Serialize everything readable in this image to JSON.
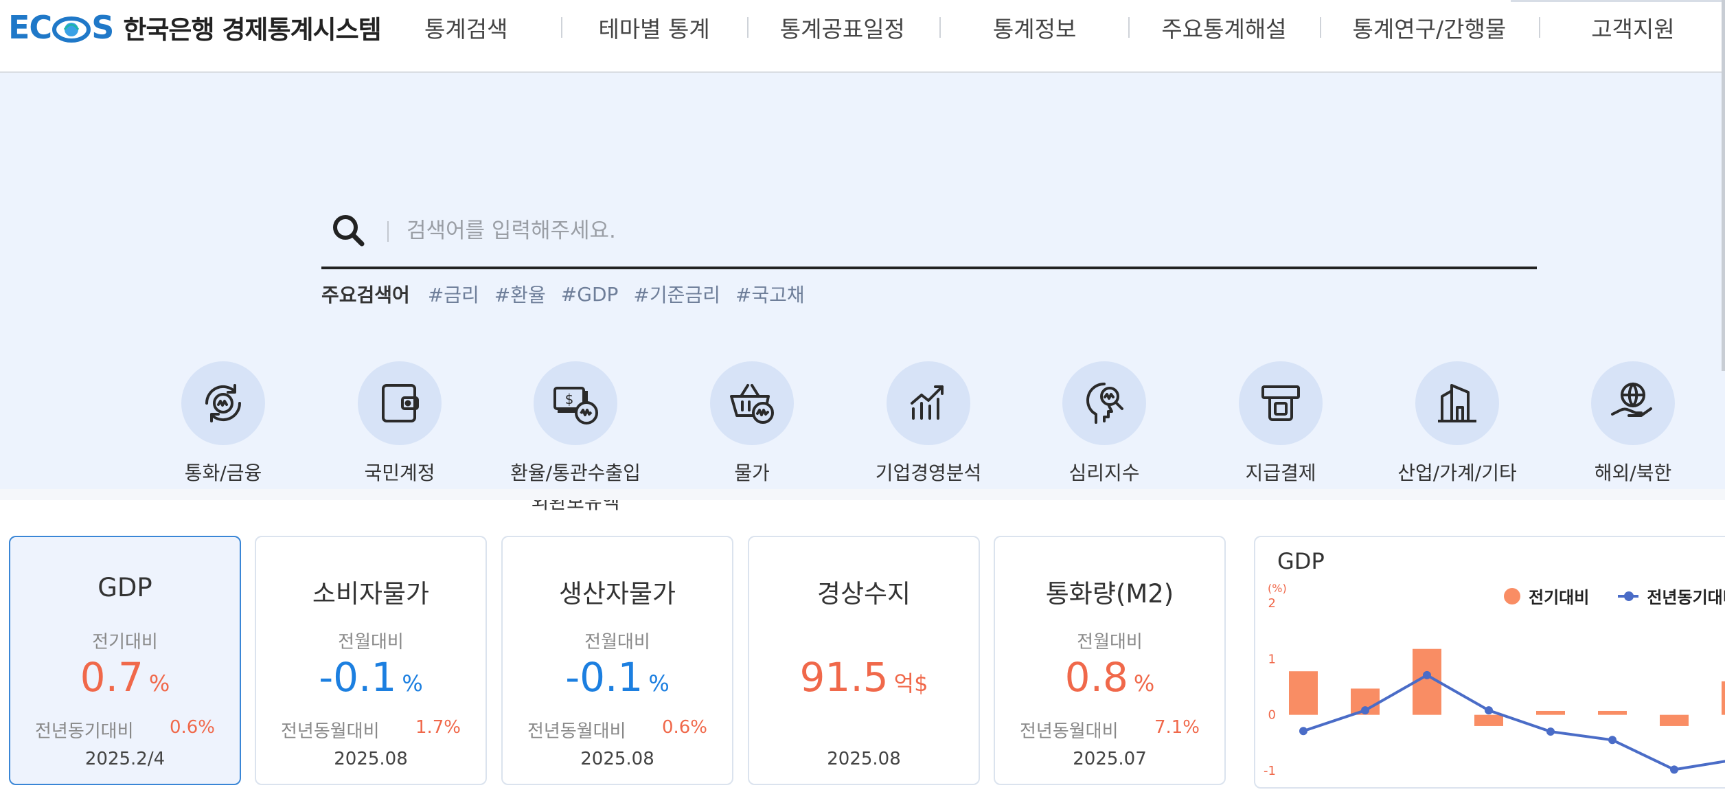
{
  "header": {
    "logo_text": "ECOS",
    "site_title": "한국은행 경제통계시스템",
    "nav": [
      "통계검색",
      "테마별 통계",
      "통계공표일정",
      "통계정보",
      "주요통계해설",
      "통계연구/간행물",
      "고객지원"
    ]
  },
  "search": {
    "placeholder": "검색어를 입력해주세요.",
    "keywords_label": "주요검색어",
    "keywords": [
      "#금리",
      "#환율",
      "#GDP",
      "#기준금리",
      "#국고채"
    ]
  },
  "categories": [
    {
      "label": "통화/금융",
      "icon": "money-cycle-icon"
    },
    {
      "label": "국민계정",
      "icon": "wallet-icon"
    },
    {
      "label": "환율/통관수출입\n외환보유액",
      "icon": "dollar-bills-icon"
    },
    {
      "label": "물가",
      "icon": "basket-icon"
    },
    {
      "label": "기업경영분석",
      "icon": "growth-chart-icon"
    },
    {
      "label": "심리지수",
      "icon": "head-magnifier-icon"
    },
    {
      "label": "지급결제",
      "icon": "card-terminal-icon"
    },
    {
      "label": "산업/가계/기타",
      "icon": "building-icon"
    },
    {
      "label": "해외/북한",
      "icon": "globe-hand-icon"
    }
  ],
  "cards": [
    {
      "title": "GDP",
      "sub_label": "전기대비",
      "value": "0.7",
      "unit": "%",
      "value_color": "red",
      "yoy_label": "전년동기대비",
      "yoy_value": "0.6%",
      "date": "2025.2/4",
      "active": true
    },
    {
      "title": "소비자물가",
      "sub_label": "전월대비",
      "value": "-0.1",
      "unit": "%",
      "value_color": "blue",
      "yoy_label": "전년동월대비",
      "yoy_value": "1.7%",
      "date": "2025.08",
      "active": false
    },
    {
      "title": "생산자물가",
      "sub_label": "전월대비",
      "value": "-0.1",
      "unit": "%",
      "value_color": "blue",
      "yoy_label": "전년동월대비",
      "yoy_value": "0.6%",
      "date": "2025.08",
      "active": false
    },
    {
      "title": "경상수지",
      "sub_label": "",
      "value": "91.5",
      "unit": "억$",
      "value_color": "red",
      "yoy_label": "",
      "yoy_value": "",
      "date": "2025.08",
      "active": false
    },
    {
      "title": "통화량(M2)",
      "sub_label": "전월대비",
      "value": "0.8",
      "unit": "%",
      "value_color": "red",
      "yoy_label": "전년동월대비",
      "yoy_value": "7.1%",
      "date": "2025.07",
      "active": false
    }
  ],
  "colors": {
    "accent_blue": "#1f78c8",
    "value_red": "#f0684a",
    "value_blue": "#1c7fe0",
    "hero_bg": "#edf3fd",
    "bar_color": "#f98d64",
    "line_color": "#4a6cc7"
  },
  "chart_data": {
    "type": "bar",
    "title": "GDP",
    "ylabel": "(%)",
    "ylim": [
      -1,
      2
    ],
    "yticks": [
      2,
      1,
      0,
      -1
    ],
    "legend_position": "top-right",
    "series": [
      {
        "name": "전기대비",
        "type": "bar",
        "values": [
          0.78,
          0.47,
          1.18,
          -0.2,
          0.07,
          0.07,
          -0.2,
          0.6
        ]
      },
      {
        "name": "전년동기대비",
        "type": "line",
        "values": [
          -0.29,
          0.08,
          0.71,
          0.08,
          -0.3,
          -0.45,
          -0.98,
          -0.8
        ]
      }
    ]
  }
}
